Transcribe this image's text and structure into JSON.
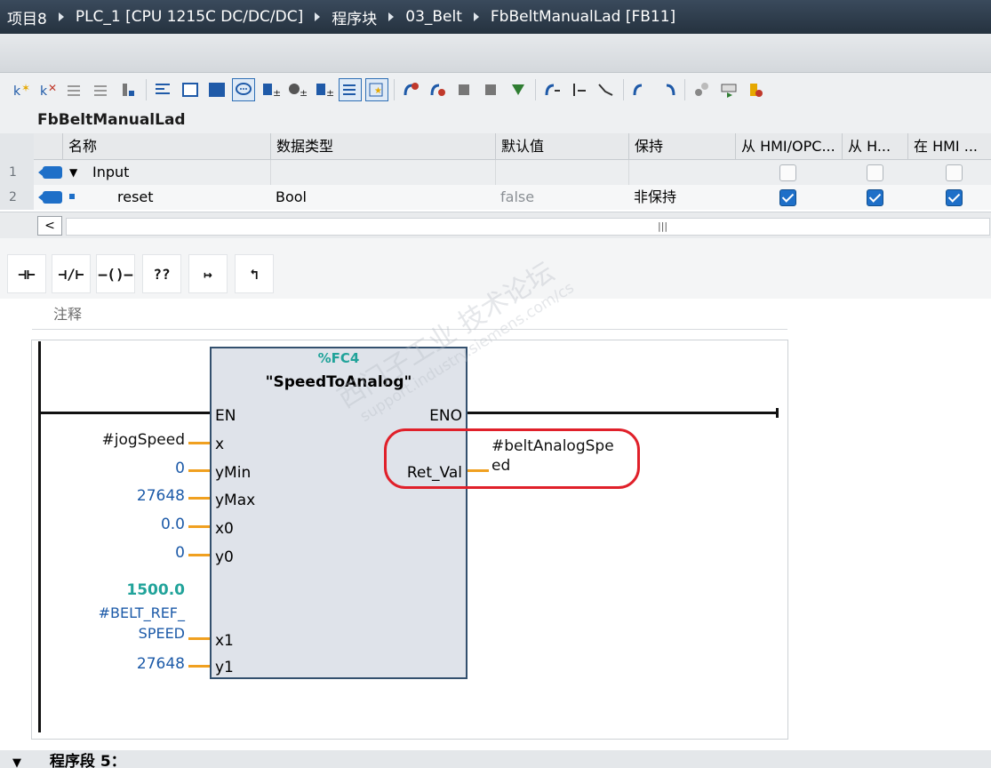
{
  "breadcrumb": {
    "project": "项目8",
    "plc": "PLC_1 [CPU 1215C DC/DC/DC]",
    "folder": "程序块",
    "subfolder": "03_Belt",
    "block": "FbBeltManualLad [FB11]"
  },
  "interface": {
    "block_name": "FbBeltManualLad",
    "columns": {
      "name": "名称",
      "datatype": "数据类型",
      "default": "默认值",
      "retain": "保持",
      "hmi_access": "从 HMI/OPC...",
      "hmi_writable": "从 H...",
      "hmi_visible": "在 HMI ..."
    },
    "rows": [
      {
        "num": "1",
        "name": "Input",
        "datatype": "",
        "default": "",
        "retain": "",
        "c1": false,
        "c2": false,
        "c3": false
      },
      {
        "num": "2",
        "name": "reset",
        "datatype": "Bool",
        "default": "false",
        "retain": "非保持",
        "c1": true,
        "c2": true,
        "c3": true
      }
    ],
    "scroll_left_glyph": "<",
    "scroll_grip": "|||"
  },
  "lad_instructions": {
    "no_contact": "⊣⊢",
    "nc_contact": "⊣/⊢",
    "coil": "–()–",
    "empty_box": "??",
    "branch_open": "↦",
    "branch_close": "↰"
  },
  "network": {
    "comment": "注释",
    "function_block": {
      "address": "%FC4",
      "name": "\"SpeedToAnalog\"",
      "en": "EN",
      "eno": "ENO",
      "inputs": [
        {
          "pin": "x",
          "value": "#jogSpeed"
        },
        {
          "pin": "yMin",
          "value": "0"
        },
        {
          "pin": "yMax",
          "value": "27648"
        },
        {
          "pin": "x0",
          "value": "0.0"
        },
        {
          "pin": "y0",
          "value": "0"
        },
        {
          "pin": "x1",
          "value_line1": "1500.0",
          "value_line2": "#BELT_REF_",
          "value_line3": "SPEED"
        },
        {
          "pin": "y1",
          "value": "27648"
        }
      ],
      "output": {
        "pin": "Ret_Val",
        "value_line1": "#beltAnalogSpe",
        "value_line2": "ed"
      }
    }
  },
  "next_network": {
    "expand_glyph": "▼",
    "title": "程序段 5："
  },
  "watermark": {
    "line1": "西门子工业  技术论坛",
    "line2": "support.industry.siemens.com/cs"
  },
  "colors": {
    "titlebar": "#2c3e50",
    "pin_orange": "#f0a020",
    "value_blue": "#1c5aa8",
    "teal_address": "#21a39a",
    "highlight_red": "#e0202a",
    "checkbox_blue": "#1e6fc8"
  }
}
